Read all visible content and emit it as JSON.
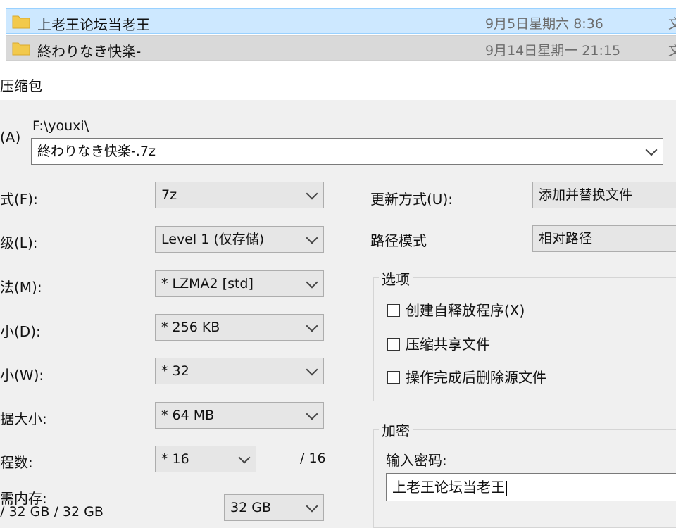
{
  "explorer": {
    "rows": [
      {
        "name": "上老王论坛当老王",
        "date": "9月5日星期六 8:36",
        "type": "文"
      },
      {
        "name": "終わりなき快楽-",
        "date": "9月14日星期一 21:15",
        "type": "文"
      }
    ]
  },
  "dialog": {
    "title": "压缩包",
    "archive": {
      "label": "(A)",
      "path": "F:\\youxi\\",
      "filename": "終わりなき快楽-.7z"
    },
    "left": [
      {
        "label": "式(F):",
        "value": "7z"
      },
      {
        "label": "级(L):",
        "value": "Level 1 (仅存储)"
      },
      {
        "label": "法(M):",
        "value": "* LZMA2 [std]"
      },
      {
        "label": "小(D):",
        "value": "* 256 KB"
      },
      {
        "label": "小(W):",
        "value": "* 32"
      },
      {
        "label": "据大小:",
        "value": "* 64 MB"
      },
      {
        "label": "程数:",
        "value": "* 16",
        "suffix": "/ 16"
      }
    ],
    "memory": {
      "label": "需内存:",
      "sub": "/ 32 GB / 32 GB",
      "value": "32 GB"
    },
    "right": {
      "update_label": "更新方式(U):",
      "update_value": "添加并替换文件",
      "path_label": "路径模式",
      "path_value": "相对路径",
      "options_title": "选项",
      "options": [
        "创建自释放程序(X)",
        "压缩共享文件",
        "操作完成后删除源文件"
      ],
      "encryption_title": "加密",
      "password_label": "输入密码:",
      "password_value": "上老王论坛当老王"
    }
  }
}
